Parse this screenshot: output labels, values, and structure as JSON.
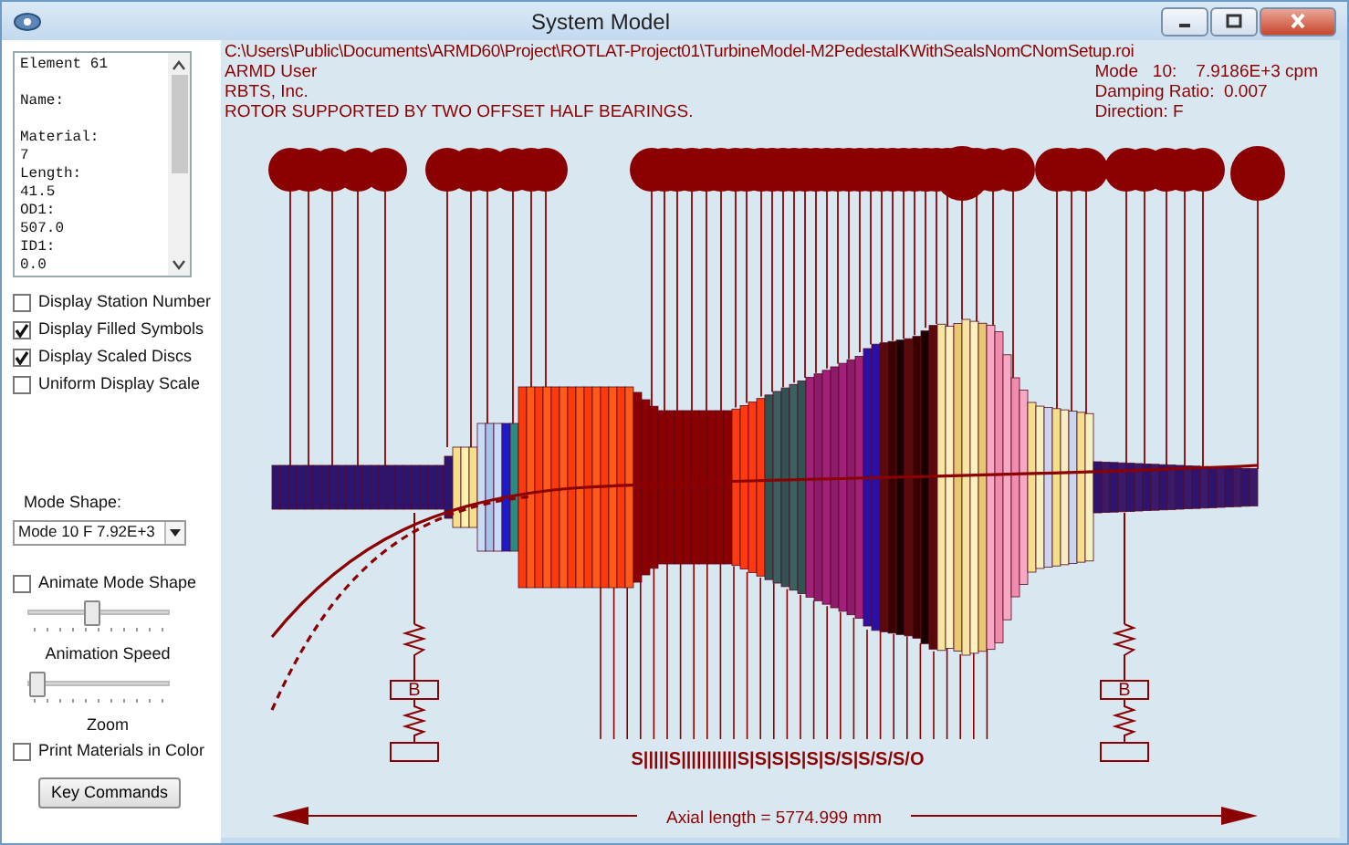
{
  "window": {
    "title": "System Model"
  },
  "element_info": {
    "lines": [
      {
        "text": "Element 61",
        "blank_after": true
      },
      {
        "text": "Name:",
        "blank_after": true
      },
      {
        "text": "Material:",
        "blank_after": false
      },
      {
        "text": "7",
        "blank_after": false
      },
      {
        "text": "Length:",
        "blank_after": false
      },
      {
        "text": "41.5",
        "blank_after": false
      },
      {
        "text": "OD1:",
        "blank_after": false
      },
      {
        "text": "507.0",
        "blank_after": false
      },
      {
        "text": "ID1:",
        "blank_after": false
      },
      {
        "text": "0.0",
        "blank_after": false
      }
    ]
  },
  "display_options": [
    {
      "label": "Display Station Number",
      "checked": false
    },
    {
      "label": "Display Filled Symbols",
      "checked": true
    },
    {
      "label": "Display Scaled Discs",
      "checked": true
    },
    {
      "label": "Uniform Display Scale",
      "checked": false
    }
  ],
  "mode_shape": {
    "label": "Mode Shape:",
    "value": "Mode 10 F 7.92E+3"
  },
  "animate": {
    "label": "Animate Mode Shape",
    "checked": false
  },
  "sliders": [
    {
      "label": "Animation Speed",
      "level": 0.45
    },
    {
      "label": "Zoom",
      "level": 0.0
    }
  ],
  "print_materials": {
    "label": "Print Materials in Color",
    "checked": false
  },
  "key_commands_button": "Key Commands",
  "header": {
    "left_lines": [
      "C:\\Users\\Public\\Documents\\ARMD60\\Project\\ROTLAT-Project01\\TurbineModel-M2PedestalKWithSealsNomCNomSetup.roi",
      "ARMD User",
      "RBTS, Inc.",
      "ROTOR SUPPORTED BY TWO OFFSET HALF BEARINGS."
    ],
    "right_lines": [
      "Mode   10:    7.9186E+3 cpm",
      "Damping Ratio:  0.007",
      "Direction: F"
    ]
  },
  "model": {
    "bearing_labels": [
      "B",
      "B"
    ],
    "seal_labels": "S|||||S|||||||||||S|S|S|S|S|S/S|S/S/S/O",
    "axial_length": "Axial length = 5774.999 mm"
  }
}
